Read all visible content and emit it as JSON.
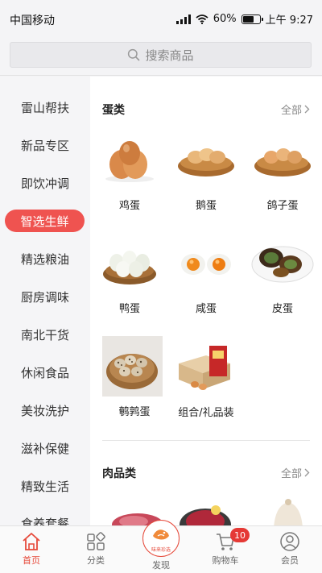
{
  "status": {
    "carrier": "中国移动",
    "battery": "60%",
    "battery_level": 0.6,
    "time": "上午 9:27"
  },
  "search": {
    "placeholder": "搜索商品"
  },
  "sidebar": {
    "items": [
      {
        "label": "雷山帮扶"
      },
      {
        "label": "新品专区"
      },
      {
        "label": "即饮冲调"
      },
      {
        "label": "智选生鲜",
        "active": true
      },
      {
        "label": "精选粮油"
      },
      {
        "label": "厨房调味"
      },
      {
        "label": "南北干货"
      },
      {
        "label": "休闲食品"
      },
      {
        "label": "美妆洗护"
      },
      {
        "label": "滋补保健"
      },
      {
        "label": "精致生活"
      },
      {
        "label": "食养套餐"
      }
    ]
  },
  "sections": [
    {
      "title": "蛋类",
      "more": "全部",
      "products": [
        {
          "name": "鸡蛋",
          "icon": "chicken-eggs"
        },
        {
          "name": "鹅蛋",
          "icon": "goose-eggs-basket"
        },
        {
          "name": "鸽子蛋",
          "icon": "pigeon-eggs-basket"
        },
        {
          "name": "鸭蛋",
          "icon": "duck-eggs-basket"
        },
        {
          "name": "咸蛋",
          "icon": "salted-egg-yolk"
        },
        {
          "name": "皮蛋",
          "icon": "century-egg"
        },
        {
          "name": "鹌鹑蛋",
          "icon": "quail-eggs-basket"
        },
        {
          "name": "组合/礼品装",
          "icon": "egg-gift-box"
        }
      ]
    },
    {
      "title": "肉品类",
      "more": "全部"
    }
  ],
  "tabbar": {
    "items": [
      {
        "label": "首页",
        "icon": "home-icon",
        "active": true
      },
      {
        "label": "分类",
        "icon": "category-icon"
      },
      {
        "label": "发现",
        "icon": "discover-icon",
        "logo_text": "味来珍选"
      },
      {
        "label": "购物车",
        "icon": "cart-icon",
        "badge": "10"
      },
      {
        "label": "会员",
        "icon": "member-icon"
      }
    ]
  },
  "colors": {
    "accent": "#ef5350",
    "tab_active": "#e64a3b",
    "badge": "#e53935"
  }
}
